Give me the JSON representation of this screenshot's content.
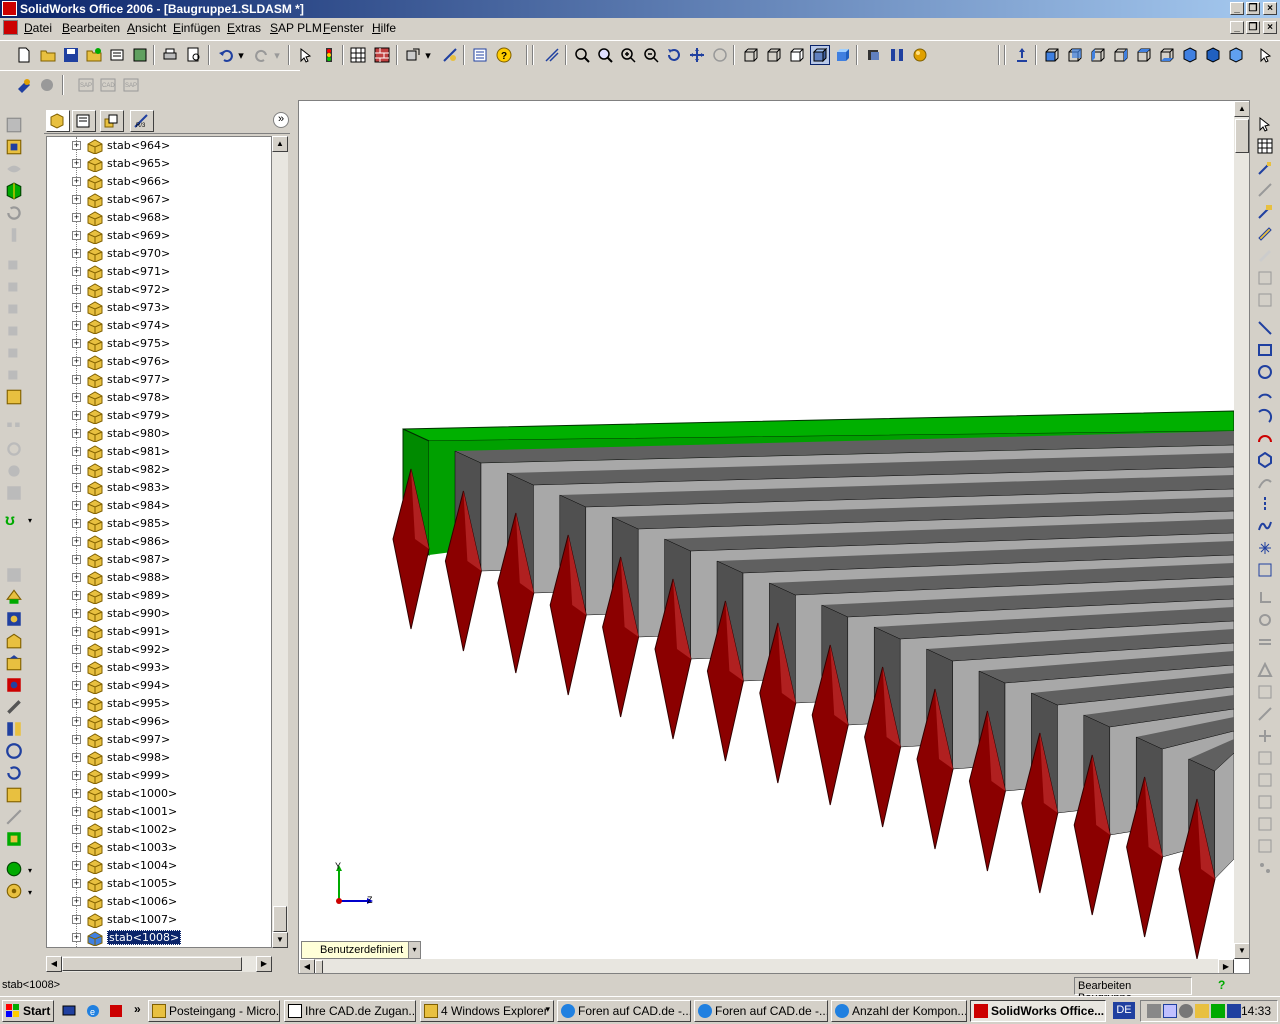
{
  "window": {
    "title": "SolidWorks Office 2006 - [Baugruppe1.SLDASM *]",
    "controls": [
      "minimize",
      "restore",
      "close"
    ]
  },
  "menu": {
    "items": [
      "Datei",
      "Bearbeiten",
      "Ansicht",
      "Einfügen",
      "Extras",
      "SAP PLM",
      "Fenster",
      "Hilfe"
    ]
  },
  "feature_tree": {
    "items": [
      "stab<964>",
      "stab<965>",
      "stab<966>",
      "stab<967>",
      "stab<968>",
      "stab<969>",
      "stab<970>",
      "stab<971>",
      "stab<972>",
      "stab<973>",
      "stab<974>",
      "stab<975>",
      "stab<976>",
      "stab<977>",
      "stab<978>",
      "stab<979>",
      "stab<980>",
      "stab<981>",
      "stab<982>",
      "stab<983>",
      "stab<984>",
      "stab<985>",
      "stab<986>",
      "stab<987>",
      "stab<988>",
      "stab<989>",
      "stab<990>",
      "stab<991>",
      "stab<992>",
      "stab<993>",
      "stab<994>",
      "stab<995>",
      "stab<996>",
      "stab<997>",
      "stab<998>",
      "stab<999>",
      "stab<1000>",
      "stab<1001>",
      "stab<1002>",
      "stab<1003>",
      "stab<1004>",
      "stab<1005>",
      "stab<1006>",
      "stab<1007>",
      "stab<1008>"
    ],
    "selected": "stab<1008>"
  },
  "viewport": {
    "view_orientation": "Benutzerdefiniert",
    "triad": {
      "y": "Y",
      "z": "Z"
    }
  },
  "statusbar": {
    "left": "stab<1008>",
    "right": "Bearbeiten Baugruppe",
    "help": "?"
  },
  "taskbar": {
    "start": "Start",
    "tasks": [
      "Posteingang - Micro...",
      "Ihre CAD.de Zugan...",
      "4 Windows Explorer",
      "Foren auf CAD.de -...",
      "Foren auf CAD.de -...",
      "Anzahl der Kompon...",
      "SolidWorks Office..."
    ],
    "language": "DE",
    "clock": "14:33"
  },
  "colors": {
    "titlebar_start": "#0a246a",
    "green_part": "#00a000",
    "gray_part": "#a0a0a0",
    "red_part": "#8b0000"
  }
}
